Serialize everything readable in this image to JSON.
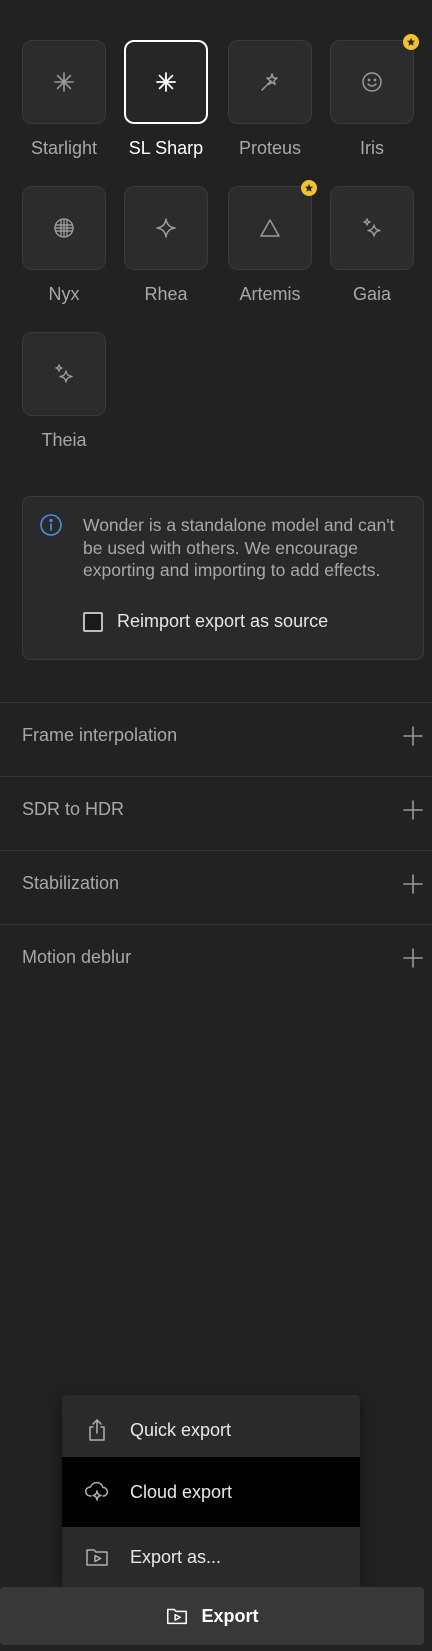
{
  "models": [
    {
      "label": "Starlight",
      "icon": "asterisk-icon",
      "selected": false,
      "premium": false
    },
    {
      "label": "SL Sharp",
      "icon": "asterisk-icon",
      "selected": true,
      "premium": false
    },
    {
      "label": "Proteus",
      "icon": "magic-wand-icon",
      "selected": false,
      "premium": false
    },
    {
      "label": "Iris",
      "icon": "smiley-icon",
      "selected": false,
      "premium": true
    },
    {
      "label": "Nyx",
      "icon": "grid-globe-icon",
      "selected": false,
      "premium": false
    },
    {
      "label": "Rhea",
      "icon": "sparkle-icon",
      "selected": false,
      "premium": false
    },
    {
      "label": "Artemis",
      "icon": "triangle-icon",
      "selected": false,
      "premium": true
    },
    {
      "label": "Gaia",
      "icon": "sparkles-icon",
      "selected": false,
      "premium": false
    },
    {
      "label": "Theia",
      "icon": "sparkles-icon",
      "selected": false,
      "premium": false
    }
  ],
  "info": {
    "icon": "info-icon",
    "text": "Wonder is a standalone model and can't be used with others. We encourage exporting and importing to add effects.",
    "checkbox_label": "Reimport export as source",
    "checkbox_checked": false
  },
  "sections": [
    {
      "label": "Frame interpolation"
    },
    {
      "label": "SDR to HDR"
    },
    {
      "label": "Stabilization"
    },
    {
      "label": "Motion deblur"
    }
  ],
  "export_menu": {
    "items": [
      {
        "label": "Quick export",
        "icon": "share-icon"
      },
      {
        "label": "Cloud export",
        "icon": "cloud-sparkle-icon"
      },
      {
        "label": "Export as...",
        "icon": "folder-play-icon"
      }
    ]
  },
  "export_button": {
    "label": "Export",
    "icon": "folder-play-icon"
  },
  "colors": {
    "background": "#222222",
    "premium_badge": "#f2c230",
    "info_accent": "#4a8fe7",
    "menu_highlight": "#000000"
  }
}
